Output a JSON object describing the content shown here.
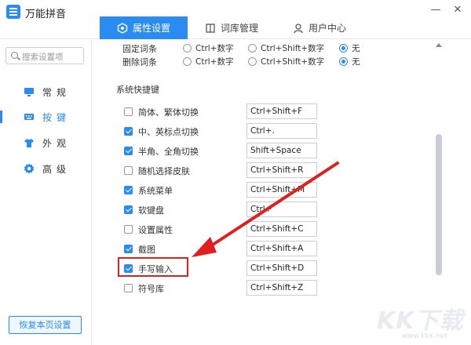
{
  "app": {
    "title": "万能拼音"
  },
  "tabs": [
    {
      "label": "属性设置",
      "icon": "hexagon-icon",
      "active": true
    },
    {
      "label": "词库管理",
      "icon": "book-icon",
      "active": false
    },
    {
      "label": "用户中心",
      "icon": "user-icon",
      "active": false
    }
  ],
  "sidebar": {
    "search_placeholder": "搜索设置项",
    "items": [
      {
        "label": "常规",
        "icon": "monitor-icon",
        "active": false
      },
      {
        "label": "按键",
        "icon": "keyboard-icon",
        "active": true
      },
      {
        "label": "外观",
        "icon": "shirt-icon",
        "active": false
      },
      {
        "label": "高级",
        "icon": "gear-icon",
        "active": false
      }
    ],
    "restore_label": "恢复本页设置"
  },
  "options": [
    {
      "label": "固定词条",
      "choices": [
        "Ctrl+数字",
        "Ctrl+Shift+数字",
        "无"
      ],
      "selected": 2
    },
    {
      "label": "删除词条",
      "choices": [
        "Ctrl+数字",
        "Ctrl+Shift+数字",
        "无"
      ],
      "selected": 2
    }
  ],
  "hotkeys": {
    "section_title": "系统快捷键",
    "items": [
      {
        "label": "简体、繁体切换",
        "key": "Ctrl+Shift+F",
        "checked": false
      },
      {
        "label": "中、英标点切换",
        "key": "Ctrl+.",
        "checked": true
      },
      {
        "label": "半角、全角切换",
        "key": "Shift+Space",
        "checked": true
      },
      {
        "label": "随机选择皮肤",
        "key": "Ctrl+Shift+R",
        "checked": false
      },
      {
        "label": "系统菜单",
        "key": "Ctrl+Shift+M",
        "checked": true
      },
      {
        "label": "软键盘",
        "key": "Ctrl+",
        "checked": true
      },
      {
        "label": "设置属性",
        "key": "Ctrl+Shift+C",
        "checked": false
      },
      {
        "label": "截图",
        "key": "Ctrl+Shift+A",
        "checked": true
      },
      {
        "label": "手写输入",
        "key": "Ctrl+Shift+D",
        "checked": true
      },
      {
        "label": "符号库",
        "key": "Ctrl+Shift+Z",
        "checked": false
      }
    ]
  },
  "window": {
    "minimize": "—",
    "close": "✕"
  },
  "watermark": {
    "text": "KK下载",
    "url": "www.kkx.net"
  },
  "colors": {
    "accent": "#2a8cf0",
    "annotation": "#e02020"
  }
}
